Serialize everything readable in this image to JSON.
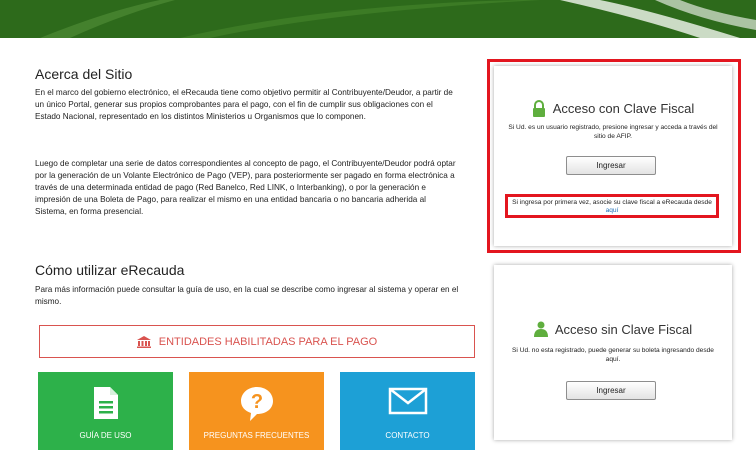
{
  "about": {
    "title": "Acerca del Sitio",
    "p1": "En el marco del gobierno electrónico, el eRecauda tiene como objetivo permitir al Contribuyente/Deudor, a partir de un único Portal, generar sus propios comprobantes para el pago, con el fin de cumplir sus obligaciones con el Estado Nacional, representado en los distintos Ministerios u Organismos que lo componen.",
    "p2": "Luego de completar una serie de datos correspondientes al concepto de pago, el Contribuyente/Deudor podrá optar por la generación de un Volante Electrónico de Pago (VEP), para posteriormente ser pagado en forma electrónica a través de una determinada entidad de pago (Red Banelco, Red LINK, o Interbanking), o por la generación e impresión de una Boleta de Pago, para realizar el mismo en una entidad bancaria o no bancaria adherida al Sistema, en forma presencial."
  },
  "usage": {
    "title": "Cómo utilizar eRecauda",
    "p": "Para más información puede consultar la guía de uso, en la cual se describe como ingresar al sistema y operar en el mismo."
  },
  "entidades_label": "ENTIDADES HABILITADAS PARA EL PAGO",
  "tiles": {
    "guia": "GUÍA DE USO",
    "faq": "PREGUNTAS FRECUENTES",
    "contacto": "CONTACTO"
  },
  "clave": {
    "title": "Acceso con Clave Fiscal",
    "desc": "Si Ud. es un usuario registrado, presione ingresar y acceda a través del sitio de AFIP.",
    "button": "Ingresar",
    "note": "Si ingresa por primera vez, asocie su clave fiscal a eRecauda desde",
    "note_link": "aquí"
  },
  "sinclave": {
    "title": "Acceso sin Clave Fiscal",
    "desc": "Si Ud. no esta registrado, puede generar su boleta ingresando desde aquí.",
    "button": "Ingresar"
  },
  "colors": {
    "banner": "#2f6e1c",
    "green_tile": "#2db14a",
    "orange_tile": "#f6931e",
    "blue_tile": "#1da0d6",
    "highlight": "#e3161f",
    "entidades": "#d9534f"
  },
  "icons": {
    "banner": "green-banner-swoosh",
    "entidades": "bank-building-icon",
    "guia": "document-icon",
    "faq": "question-mark-icon",
    "contacto": "envelope-icon",
    "clave": "lock-icon",
    "sinclave": "user-icon"
  }
}
